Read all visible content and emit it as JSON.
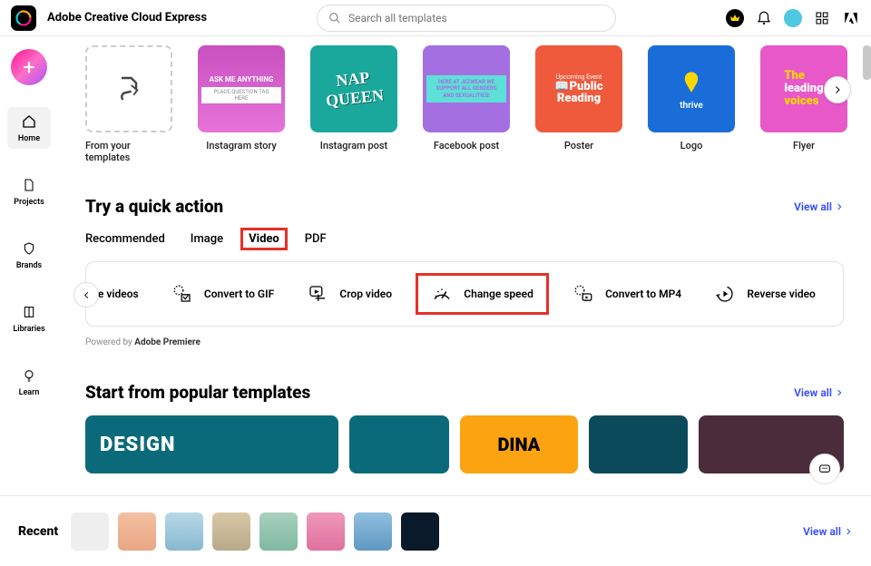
{
  "header": {
    "title": "Adobe Creative Cloud Express",
    "search_placeholder": "Search all templates"
  },
  "sidebar": {
    "items": [
      {
        "label": "Home"
      },
      {
        "label": "Projects"
      },
      {
        "label": "Brands"
      },
      {
        "label": "Libraries"
      },
      {
        "label": "Learn"
      }
    ]
  },
  "templates": [
    {
      "label": "From your templates"
    },
    {
      "label": "Instagram story"
    },
    {
      "label": "Instagram post"
    },
    {
      "label": "Facebook post"
    },
    {
      "label": "Poster"
    },
    {
      "label": "Logo"
    },
    {
      "label": "Flyer"
    }
  ],
  "quick_action": {
    "title": "Try a quick action",
    "view_all": "View all",
    "tabs": [
      "Recommended",
      "Image",
      "Video",
      "PDF"
    ],
    "active_tab": "Video",
    "actions": [
      {
        "label": "ge videos"
      },
      {
        "label": "Convert to GIF"
      },
      {
        "label": "Crop video"
      },
      {
        "label": "Change speed"
      },
      {
        "label": "Convert to MP4"
      },
      {
        "label": "Reverse video"
      }
    ],
    "powered_prefix": "Powered by ",
    "powered_product": "Adobe Premiere"
  },
  "popular": {
    "title": "Start from popular templates",
    "view_all": "View all"
  },
  "recent": {
    "label": "Recent",
    "view_all": "View all"
  }
}
